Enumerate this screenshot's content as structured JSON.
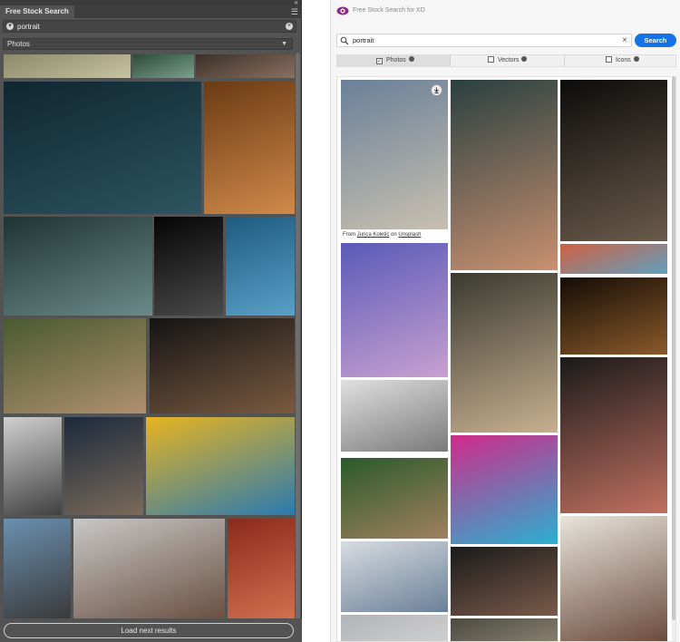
{
  "photoshop_panel": {
    "tab_title": "Free Stock Search",
    "search_query": "portrait",
    "filter_selected": "Photos",
    "load_more_label": "Load next results"
  },
  "xd_panel": {
    "title": "Free Stock Search for XD",
    "search_query": "portrait",
    "clear_symbol": "×",
    "search_button_label": "Search",
    "tabs": [
      {
        "label": "Photos",
        "checked": true
      },
      {
        "label": "Vectors",
        "checked": false
      },
      {
        "label": "Icons",
        "checked": false
      }
    ],
    "credit": {
      "prefix": "From",
      "author": "Jurica Koletić",
      "connector": "on",
      "source": "Unsplash"
    }
  },
  "colors": {
    "ps_panel_bg": "#535353",
    "xd_accent": "#1473e6",
    "xd_logo": "#8b2a8e"
  },
  "icons": {
    "ps_search": "search-circle-icon",
    "ps_clear": "clear-circle-icon",
    "ps_menu": "hamburger-menu-icon",
    "xd_search": "magnifier-icon",
    "xd_logo": "eye-logo-icon",
    "xd_download": "download-icon",
    "xd_info": "info-icon"
  },
  "ps_images": [
    {
      "name": "partial-top-1",
      "c1": "#8a8a6a",
      "c2": "#c8c2a0"
    },
    {
      "name": "partial-top-2",
      "c1": "#2e4a3a",
      "c2": "#7aa08a"
    },
    {
      "name": "partial-top-3",
      "c1": "#3a3028",
      "c2": "#8a7060"
    },
    {
      "name": "curly-haired-child",
      "c1": "#0f2630",
      "c2": "#2d5560"
    },
    {
      "name": "smiling-redhead",
      "c1": "#6a3a14",
      "c2": "#d08a4a"
    },
    {
      "name": "bald-man-profile",
      "c1": "#1e3434",
      "c2": "#6a8a88"
    },
    {
      "name": "woman-dark-profile",
      "c1": "#050505",
      "c2": "#4a4a4a"
    },
    {
      "name": "hooded-woman-blue-wall",
      "c1": "#1f5a80",
      "c2": "#5aa0c8"
    },
    {
      "name": "woman-in-field",
      "c1": "#4a5a30",
      "c2": "#b09070"
    },
    {
      "name": "woman-glitter-face",
      "c1": "#141414",
      "c2": "#7a5a40"
    },
    {
      "name": "smiling-man-bw",
      "c1": "#d0d0d0",
      "c2": "#404040"
    },
    {
      "name": "old-bearded-man",
      "c1": "#1c2a3c",
      "c2": "#7a6a5a"
    },
    {
      "name": "kingfisher-bird",
      "c1": "#e8b420",
      "c2": "#2a7ab0"
    },
    {
      "name": "man-cap-beach",
      "c1": "#6a90b0",
      "c2": "#3a3a3a"
    },
    {
      "name": "bearded-man-sea",
      "c1": "#c8c8c8",
      "c2": "#6a5040"
    },
    {
      "name": "woman-glasses-red",
      "c1": "#8a2a1a",
      "c2": "#d07050"
    }
  ],
  "xd_images": [
    {
      "name": "man-grey-sweater",
      "c1": "#6a8098",
      "c2": "#c8c0b0"
    },
    {
      "name": "woman-bokeh-lights",
      "c1": "#2a4040",
      "c2": "#c89070"
    },
    {
      "name": "man-dark-background",
      "c1": "#0c0c0c",
      "c2": "#6a5a4a"
    },
    {
      "name": "face-collage",
      "c1": "#d06040",
      "c2": "#60a0c0"
    },
    {
      "name": "woman-blue-light",
      "c1": "#5a5ab8",
      "c2": "#c8a0d0"
    },
    {
      "name": "woman-striped-shirt",
      "c1": "#3a3a30",
      "c2": "#c8b090"
    },
    {
      "name": "lion",
      "c1": "#140c06",
      "c2": "#8a5a2a"
    },
    {
      "name": "man-white-shirt",
      "c1": "#e0e0e0",
      "c2": "#7a7a7a"
    },
    {
      "name": "woman-flower-crown",
      "c1": "#1a1a1a",
      "c2": "#c07060"
    },
    {
      "name": "face-paint-colors",
      "c1": "#d02a8a",
      "c2": "#2ab0d0"
    },
    {
      "name": "woman-in-foliage",
      "c1": "#2a5a2a",
      "c2": "#a08060"
    },
    {
      "name": "older-man-smiling",
      "c1": "#d8dce0",
      "c2": "#6a8098"
    },
    {
      "name": "woman-hijab",
      "c1": "#1a1a1a",
      "c2": "#7a5a4a"
    },
    {
      "name": "curly-woman-laughing",
      "c1": "#e8e4dc",
      "c2": "#6a4a3a"
    },
    {
      "name": "partial-bottom-1",
      "c1": "#b0b4b8",
      "c2": "#d0d0d0"
    },
    {
      "name": "partial-bottom-2",
      "c1": "#4a4a40",
      "c2": "#8a8070"
    }
  ]
}
